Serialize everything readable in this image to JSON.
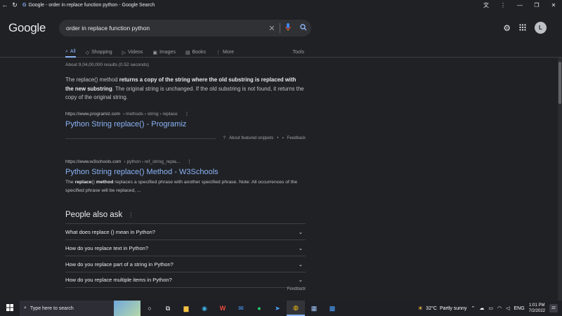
{
  "window": {
    "title": "Google - order in replace function python - Google Search"
  },
  "search": {
    "logo": "Google",
    "query": "order in replace function python",
    "avatar_letter": "L",
    "tabs": [
      {
        "label": "All",
        "icon": "search-icon"
      },
      {
        "label": "Shopping",
        "icon": "tag-icon"
      },
      {
        "label": "Videos",
        "icon": "play-icon"
      },
      {
        "label": "Images",
        "icon": "image-icon"
      },
      {
        "label": "Books",
        "icon": "book-icon"
      },
      {
        "label": "More",
        "icon": "more-icon"
      }
    ],
    "tools_label": "Tools"
  },
  "results": {
    "stats": "About 9,04,00,000 results (0.52 seconds)",
    "snippet_pre": "The replace() method ",
    "snippet_bold": "returns a copy of the string where the old substring is replaced with the new substring",
    "snippet_post": ". The original string is unchanged. If the old substring is not found, it returns the copy of the original string.",
    "r1_site": "https://www.programiz.com",
    "r1_path": "› methods › string › replace",
    "r1_title": "Python String replace() - Programiz",
    "about_snippets": "About featured snippets",
    "feedback": "Feedback",
    "r2_site": "https://www.w3schools.com",
    "r2_path": "› python › ref_string_repla...",
    "r2_title": "Python String replace() Method - W3Schools",
    "r2_desc_pre": "The ",
    "r2_desc_b1": "replace",
    "r2_desc_mid": "() ",
    "r2_desc_b2": "method",
    "r2_desc_post": " replaces a specified phrase with another specified phrase. Note: All occurrences of the specified phrase will be replaced, ..."
  },
  "paa": {
    "title": "People also ask",
    "questions": [
      "What does replace () mean in Python?",
      "How do you replace text in Python?",
      "How do you replace part of a string in Python?",
      "How do you replace multiple items in Python?"
    ],
    "feedback": "Feedback"
  },
  "taskbar": {
    "search_placeholder": "Type here to search",
    "temperature": "32°C",
    "weather": "Partly sunny",
    "language": "ENG",
    "time": "1:01 PM",
    "date": "7/2/2022",
    "notifications": "22"
  }
}
